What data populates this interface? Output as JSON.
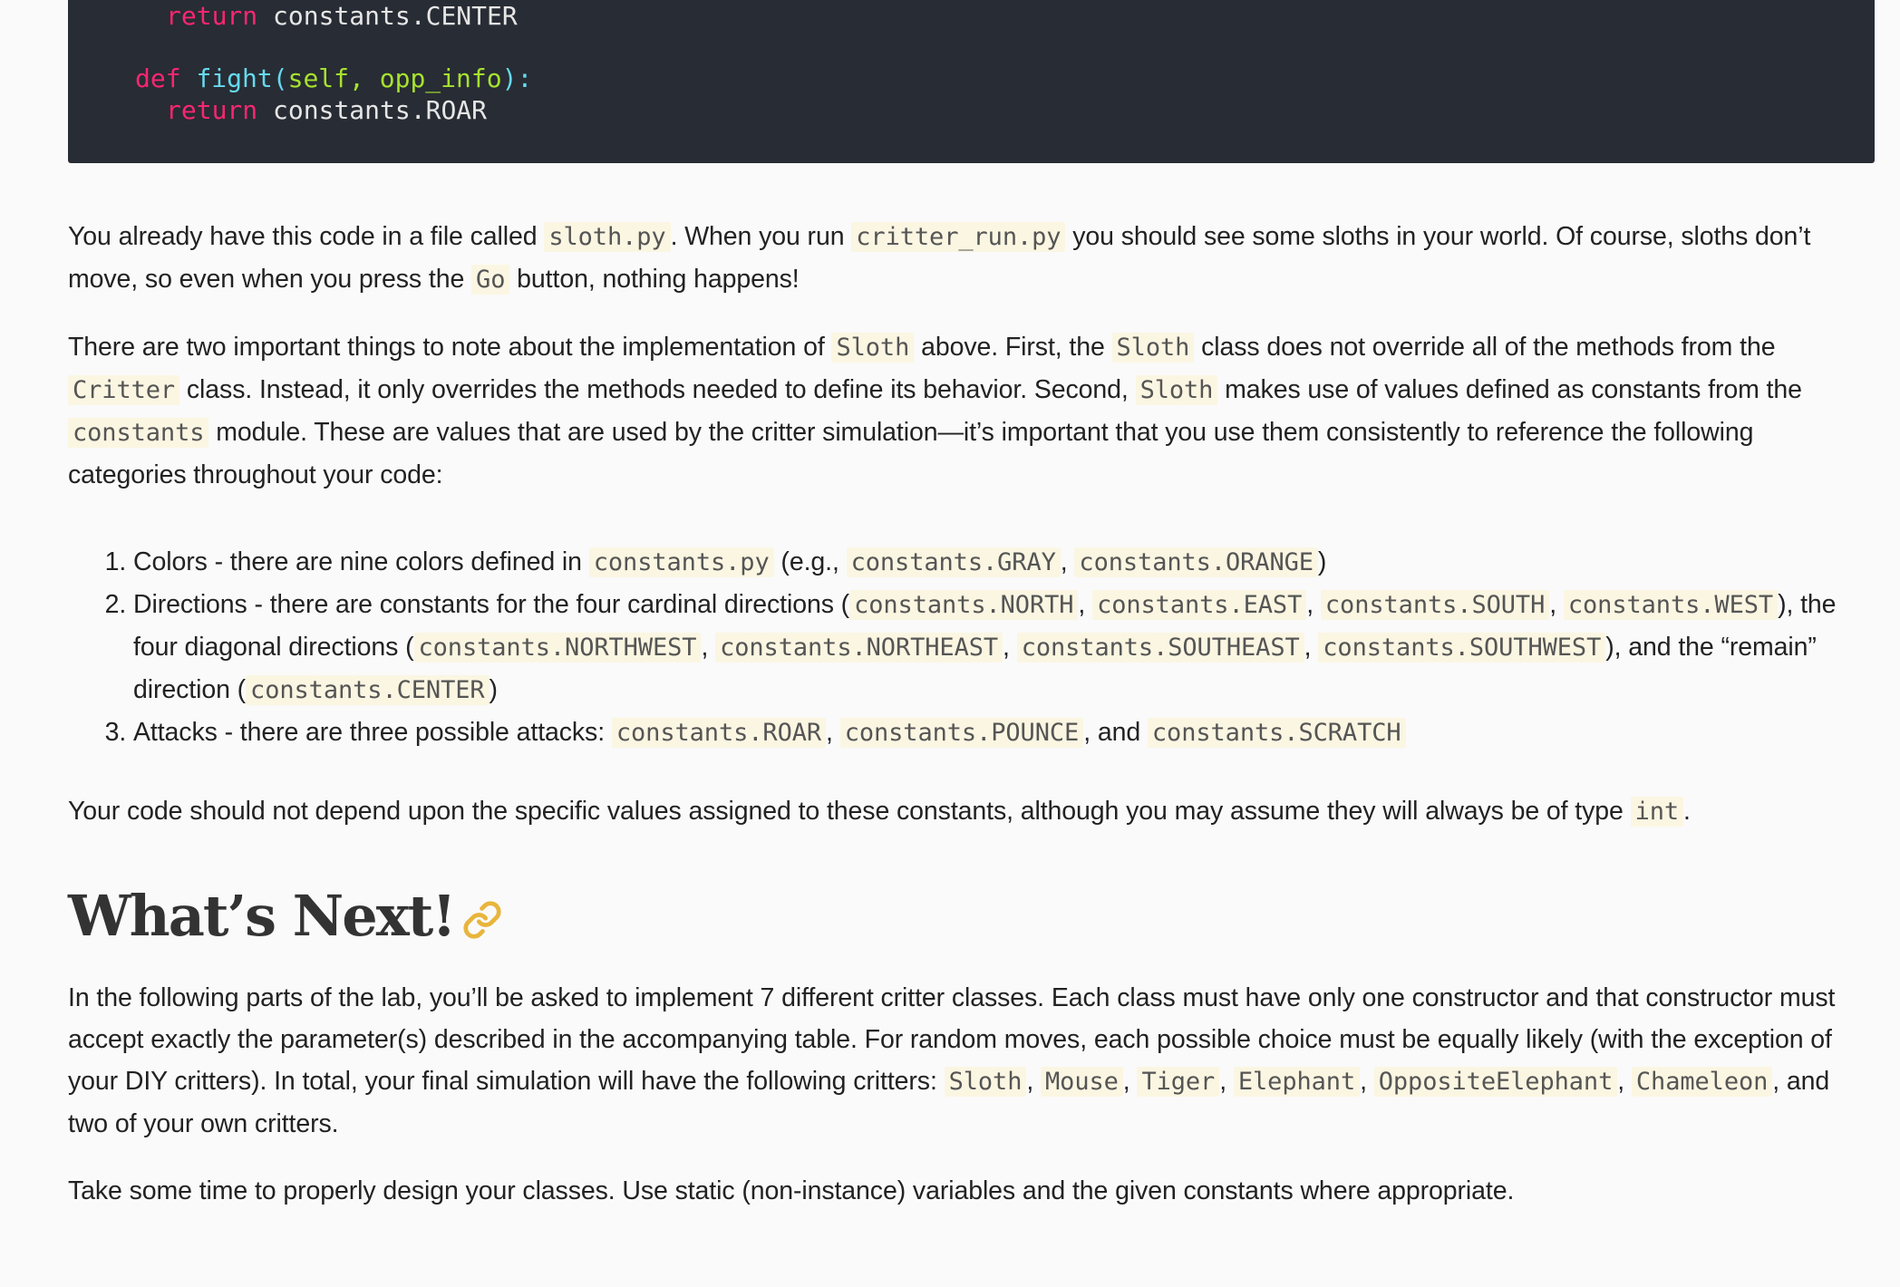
{
  "code": {
    "line1": {
      "kw": "return",
      "rest": " constants.CENTER"
    },
    "line2": {
      "kw": "def",
      "fn": "fight",
      "paren_open": "(",
      "params": "self, opp_info",
      "paren_close": "):"
    },
    "line3": {
      "kw": "return",
      "rest": " constants.ROAR"
    }
  },
  "p1": {
    "t1": "You already have this code in a file called ",
    "c1": "sloth.py",
    "t2": ". When you run ",
    "c2": "critter_run.py",
    "t3": " you should see some sloths in your world. Of course, sloths don’t move, so even when you press the ",
    "c3": "Go",
    "t4": " button, nothing happens!"
  },
  "p2": {
    "t1": "There are two important things to note about the implementation of ",
    "c1": "Sloth",
    "t2": " above. First, the ",
    "c2": "Sloth",
    "t3": " class does not override all of the methods from the ",
    "c3": "Critter",
    "t4": " class. Instead, it only overrides the methods needed to define its behavior. Second, ",
    "c4": "Sloth",
    "t5": " makes use of values defined as constants from the ",
    "c5": "constants",
    "t6": " module. These are values that are used by the critter simulation—it’s important that you use them consistently to reference the following categories throughout your code:"
  },
  "list": {
    "item1": {
      "t1": "Colors - there are nine colors defined in ",
      "c1": "constants.py",
      "t2": " (e.g., ",
      "c2": "constants.GRAY",
      "t3": ", ",
      "c3": "constants.ORANGE",
      "t4": ")"
    },
    "item2": {
      "t1": "Directions - there are constants for the four cardinal directions (",
      "c1": "constants.NORTH",
      "t2": ", ",
      "c2": "constants.EAST",
      "t3": ", ",
      "c3": "constants.SOUTH",
      "t4": ", ",
      "c4": "constants.WEST",
      "t5": "), the four diagonal directions (",
      "c5": "constants.NORTHWEST",
      "t6": ", ",
      "c6": "constants.NORTHEAST",
      "t7": ", ",
      "c7": "constants.SOUTHEAST",
      "t8": ", ",
      "c8": "constants.SOUTHWEST",
      "t9": "), and the “remain” direction (",
      "c9": "constants.CENTER",
      "t10": ")"
    },
    "item3": {
      "t1": "Attacks - there are three possible attacks: ",
      "c1": "constants.ROAR",
      "t2": ", ",
      "c2": "constants.POUNCE",
      "t3": ", and ",
      "c3": "constants.SCRATCH"
    }
  },
  "p3": {
    "t1": "Your code should not depend upon the specific values assigned to these constants, although you may assume they will always be of type ",
    "c1": "int",
    "t2": "."
  },
  "heading": {
    "text": "What’s Next!",
    "icon": "link-icon",
    "icon_color": "#e8b53c"
  },
  "p4": {
    "t1": "In the following parts of the lab, you’ll be asked to implement 7 different critter classes. Each class must have only one constructor and that constructor must accept exactly the parameter(s) described in the accompanying table. For random moves, each possible choice must be equally likely (with the exception of your DIY critters). In total, your final simulation will have the following critters: ",
    "c1": "Sloth",
    "t2": ", ",
    "c2": "Mouse",
    "t3": ", ",
    "c3": "Tiger",
    "t4": ", ",
    "c4": "Elephant",
    "t5": ", ",
    "c5": "OppositeElephant",
    "t6": ", ",
    "c6": "Chameleon",
    "t7": ", and two of your own critters."
  },
  "p5": {
    "text": "Take some time to properly design your classes. Use static (non-instance) variables and the given constants where appropriate."
  }
}
